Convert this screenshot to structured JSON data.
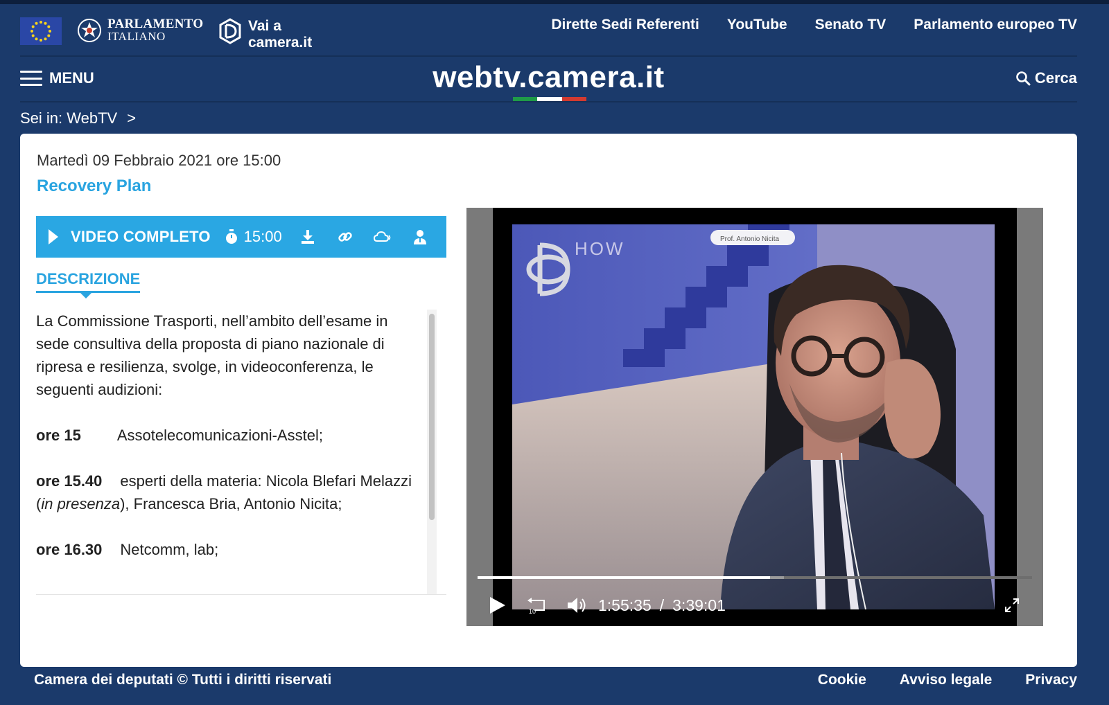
{
  "header": {
    "parliament_line1": "PARLAMENTO",
    "parliament_line2": "ITALIANO",
    "camera_line1": "Vai a",
    "camera_line2": "camera.it",
    "links": [
      "Dirette Sedi Referenti",
      "YouTube",
      "Senato TV",
      "Parlamento europeo TV"
    ]
  },
  "nav": {
    "menu_label": "MENU",
    "site_title": "webtv.camera.it",
    "search_label": "Cerca"
  },
  "breadcrumb": {
    "prefix": "Sei in: WebTV",
    "separator": ">"
  },
  "event": {
    "date": "Martedì 09 Febbraio 2021 ore 15:00",
    "title": "Recovery Plan"
  },
  "toolbar": {
    "label": "VIDEO COMPLETO",
    "time": "15:00"
  },
  "description": {
    "tab_label": "DESCRIZIONE",
    "intro": "La Commissione Trasporti, nell’ambito dell’esame in sede consultiva della proposta di piano nazionale di ripresa e resilienza, svolge, in videoconferenza, le seguenti audizioni:",
    "items": [
      {
        "time": "ore 15",
        "pre": "Assotelecomunicazioni-Asstel;",
        "italic": "",
        "post": ""
      },
      {
        "time": "ore 15.40",
        "pre": "esperti della materia: Nicola Blefari Melazzi (",
        "italic": "in presenza",
        "post": "), Francesca Bria, Antonio Nicita;"
      },
      {
        "time": "ore 16.30",
        "pre": "Netcomm, lab;",
        "italic": "",
        "post": ""
      }
    ]
  },
  "player": {
    "current_time": "1:55:35",
    "separator": "/",
    "duration": "3:39:01",
    "skip_seconds": "10",
    "progress_fraction": 0.527,
    "buffer_fraction": 0.552,
    "speaker_tag": "Prof. Antonio Nicita",
    "background_text": "HOW"
  },
  "footer": {
    "copyright": "Camera dei deputati © Tutti i diritti riservati",
    "links": [
      "Cookie",
      "Avviso legale",
      "Privacy"
    ]
  },
  "colors": {
    "background": "#1b3a6b",
    "accent": "#2aa7e3",
    "flag_green": "#1f9a48",
    "flag_white": "#ffffff",
    "flag_red": "#d23a30"
  }
}
